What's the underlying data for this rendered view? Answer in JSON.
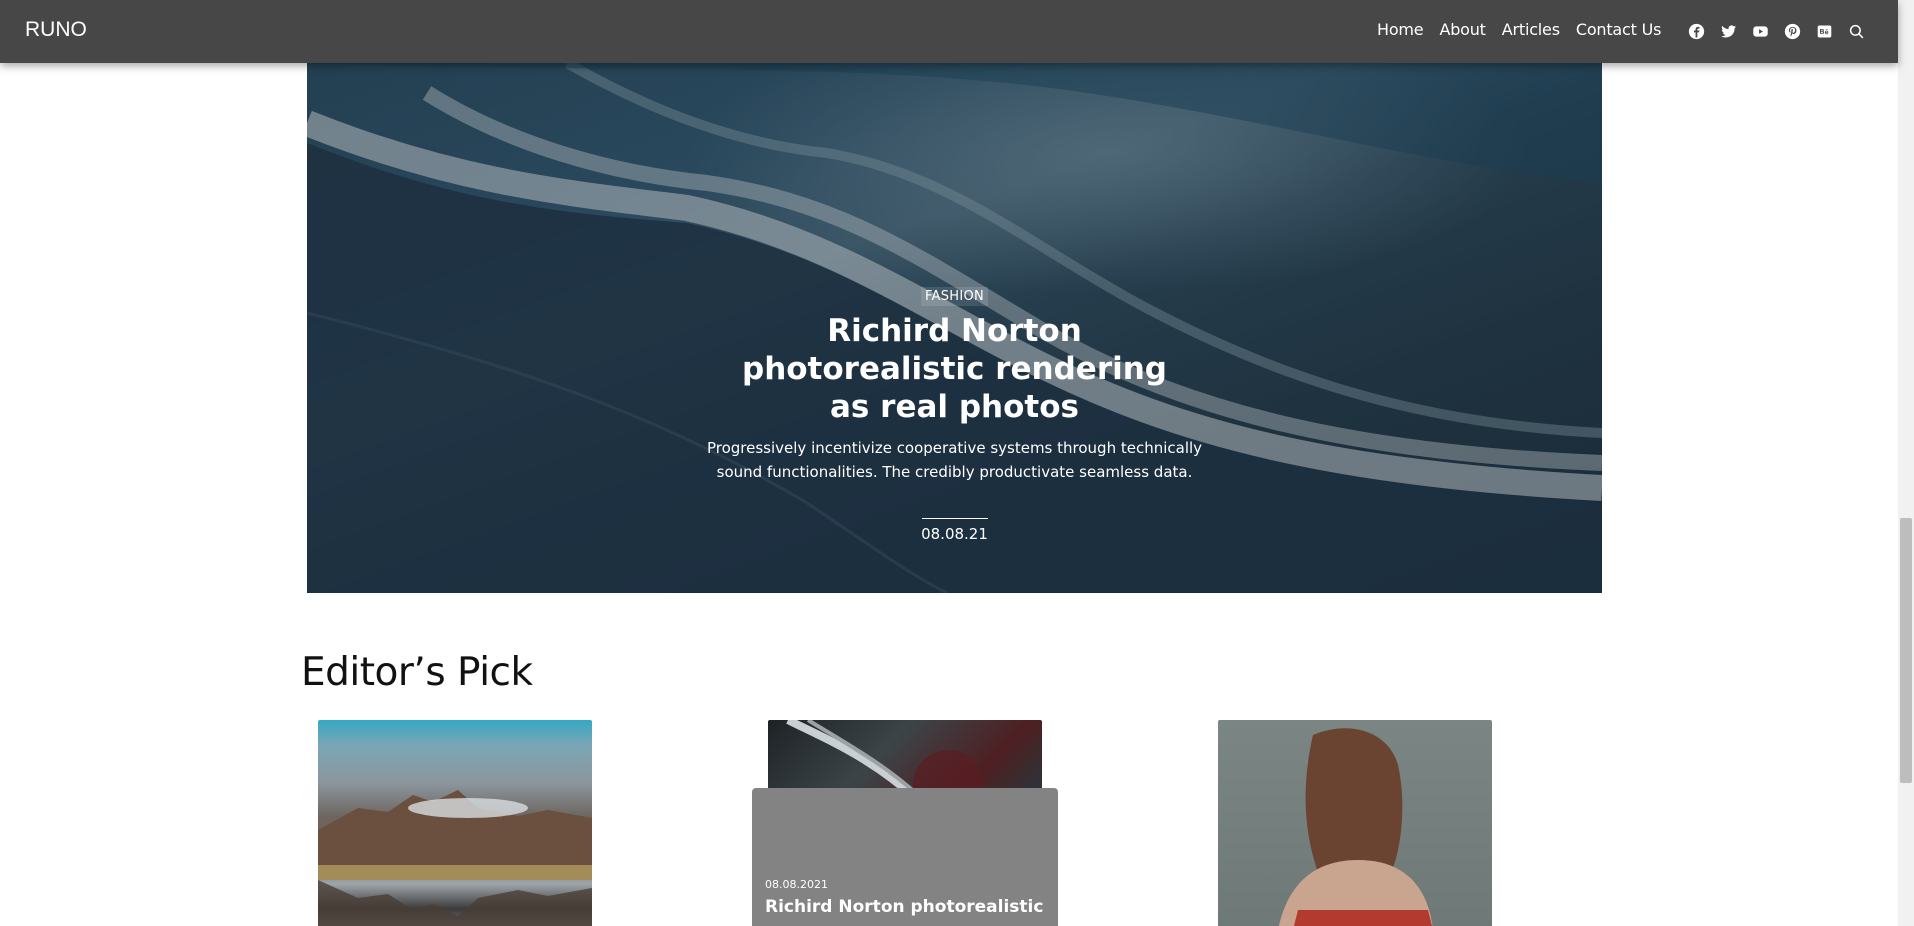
{
  "navbar": {
    "logo": "RUNO",
    "links": [
      "Home",
      "About",
      "Articles",
      "Contact Us"
    ],
    "social_icons": [
      "facebook-icon",
      "twitter-icon",
      "youtube-icon",
      "pinterest-icon",
      "behance-icon",
      "search-icon"
    ]
  },
  "hero": {
    "category": "FASHION",
    "title": "Richird Norton photorealistic rendering as real photos",
    "excerpt": "Progressively incentivize cooperative systems through technically sound functionalities. The credibly productivate seamless data.",
    "date": "08.08.21"
  },
  "editors_pick": {
    "title": "Editor’s Pick",
    "featured_card": {
      "date": "08.08.2021",
      "title": "Richird Norton photorealistic"
    }
  },
  "colors": {
    "navbar": "#474747",
    "card_overlay": "#838383"
  }
}
